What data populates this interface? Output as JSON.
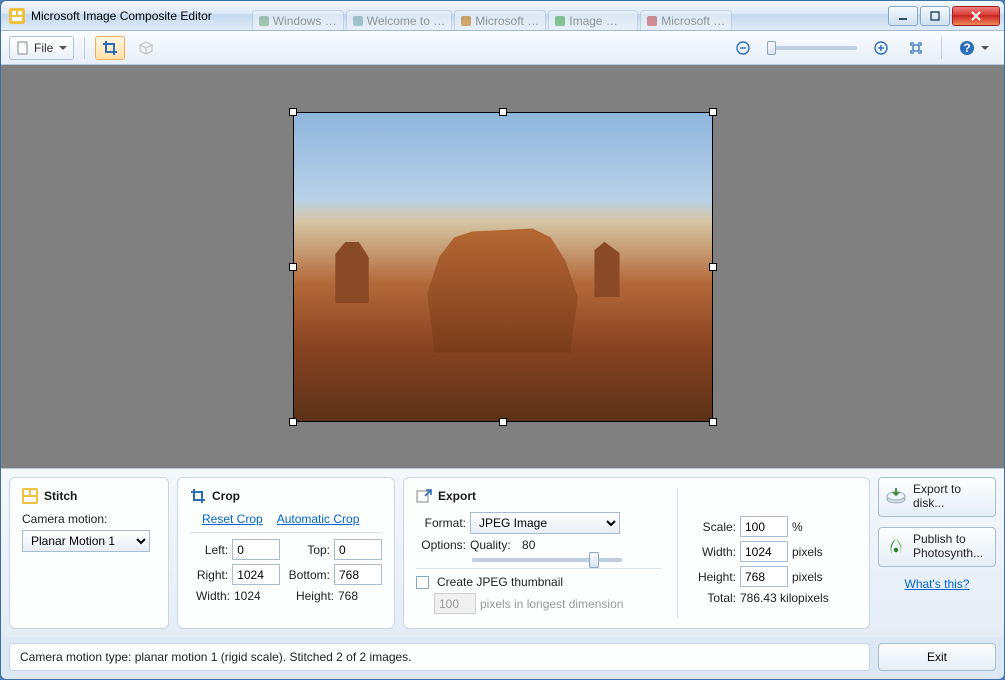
{
  "window": {
    "title": "Microsoft Image Composite Editor"
  },
  "bg_tabs": [
    "Windows …",
    "Welcome to …",
    "Microsoft …",
    "Image …",
    "Microsoft …"
  ],
  "toolbar": {
    "file_label": "File"
  },
  "stitch": {
    "heading": "Stitch",
    "camera_motion_label": "Camera motion:",
    "camera_motion_value": "Planar Motion 1"
  },
  "crop": {
    "heading": "Crop",
    "reset_label": "Reset Crop",
    "auto_label": "Automatic Crop",
    "left_label": "Left:",
    "left": "0",
    "top_label": "Top:",
    "top": "0",
    "right_label": "Right:",
    "right": "1024",
    "bottom_label": "Bottom:",
    "bottom": "768",
    "width_label": "Width:",
    "width": "1024",
    "height_label": "Height:",
    "height": "768"
  },
  "export": {
    "heading": "Export",
    "format_label": "Format:",
    "format_value": "JPEG Image",
    "options_label": "Options:",
    "quality_label": "Quality:",
    "quality_value": "80",
    "thumb_label": "Create JPEG thumbnail",
    "thumb_pixels": "100",
    "thumb_caption": "pixels in longest dimension",
    "scale_label": "Scale:",
    "scale": "100",
    "scale_unit": "%",
    "width_label": "Width:",
    "width": "1024",
    "px_unit": "pixels",
    "height_label": "Height:",
    "height": "768",
    "total_label": "Total:",
    "total": "786.43 kilopixels"
  },
  "actions": {
    "export_disk": "Export to disk...",
    "publish": "Publish to Photosynth...",
    "whats_this": "What's this?",
    "exit": "Exit"
  },
  "status": "Camera motion type: planar motion 1 (rigid scale). Stitched 2 of 2 images."
}
